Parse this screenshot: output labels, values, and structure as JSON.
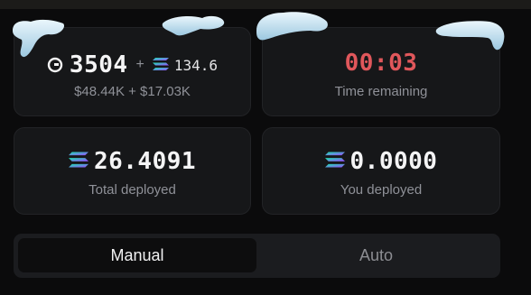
{
  "stats": {
    "ore_amount": "3504",
    "plus": "+",
    "sol_amount": "134.6",
    "usd_line": "$48.44K + $17.03K"
  },
  "timer": {
    "value": "00:03",
    "label": "Time remaining"
  },
  "total": {
    "value": "26.4091",
    "label": "Total deployed"
  },
  "mine": {
    "value": "0.0000",
    "label": "You deployed"
  },
  "mode_tabs": {
    "manual": "Manual",
    "auto": "Auto",
    "selected": "Manual"
  },
  "icons": {
    "ore": "ore-token-icon",
    "sol": "solana-icon"
  },
  "colors": {
    "timer": "#e0575b",
    "snow": "#cfe6f3"
  }
}
